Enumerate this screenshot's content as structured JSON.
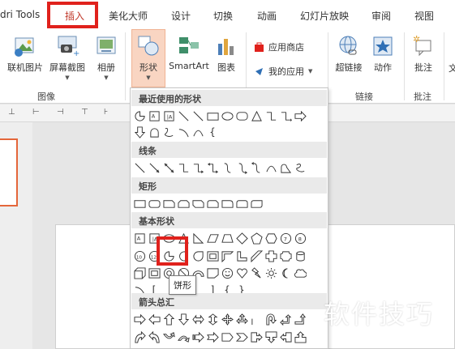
{
  "tabs": [
    {
      "label": "dri Tools",
      "active": false
    },
    {
      "label": "插入",
      "active": true
    },
    {
      "label": "美化大师",
      "active": false
    },
    {
      "label": "设计",
      "active": false
    },
    {
      "label": "切换",
      "active": false
    },
    {
      "label": "动画",
      "active": false
    },
    {
      "label": "幻灯片放映",
      "active": false
    },
    {
      "label": "审阅",
      "active": false
    },
    {
      "label": "视图",
      "active": false
    }
  ],
  "ribbon": {
    "online_picture": "联机图片",
    "screenshot": "屏幕截图",
    "album": "相册",
    "images_group": "图像",
    "shapes": "形状",
    "smartart": "SmartArt",
    "chart": "图表",
    "app_store": "应用商店",
    "my_apps": "我的应用",
    "hyperlink": "超链接",
    "action": "动作",
    "links_group": "链接",
    "comment": "批注",
    "comments_group": "批注",
    "text_partial": "文"
  },
  "dropdown": {
    "recent_title": "最近使用的形状",
    "lines_title": "线条",
    "rect_title": "矩形",
    "basic_title": "基本形状",
    "arrows_title": "箭头总汇"
  },
  "tooltip": "饼形",
  "watermark": "软件技巧",
  "colors": {
    "highlight_red": "#e0211c",
    "active_tab_text": "#c0392b",
    "shape_button_bg": "#f9d5c2",
    "thumbnail_border": "#e4663a"
  }
}
